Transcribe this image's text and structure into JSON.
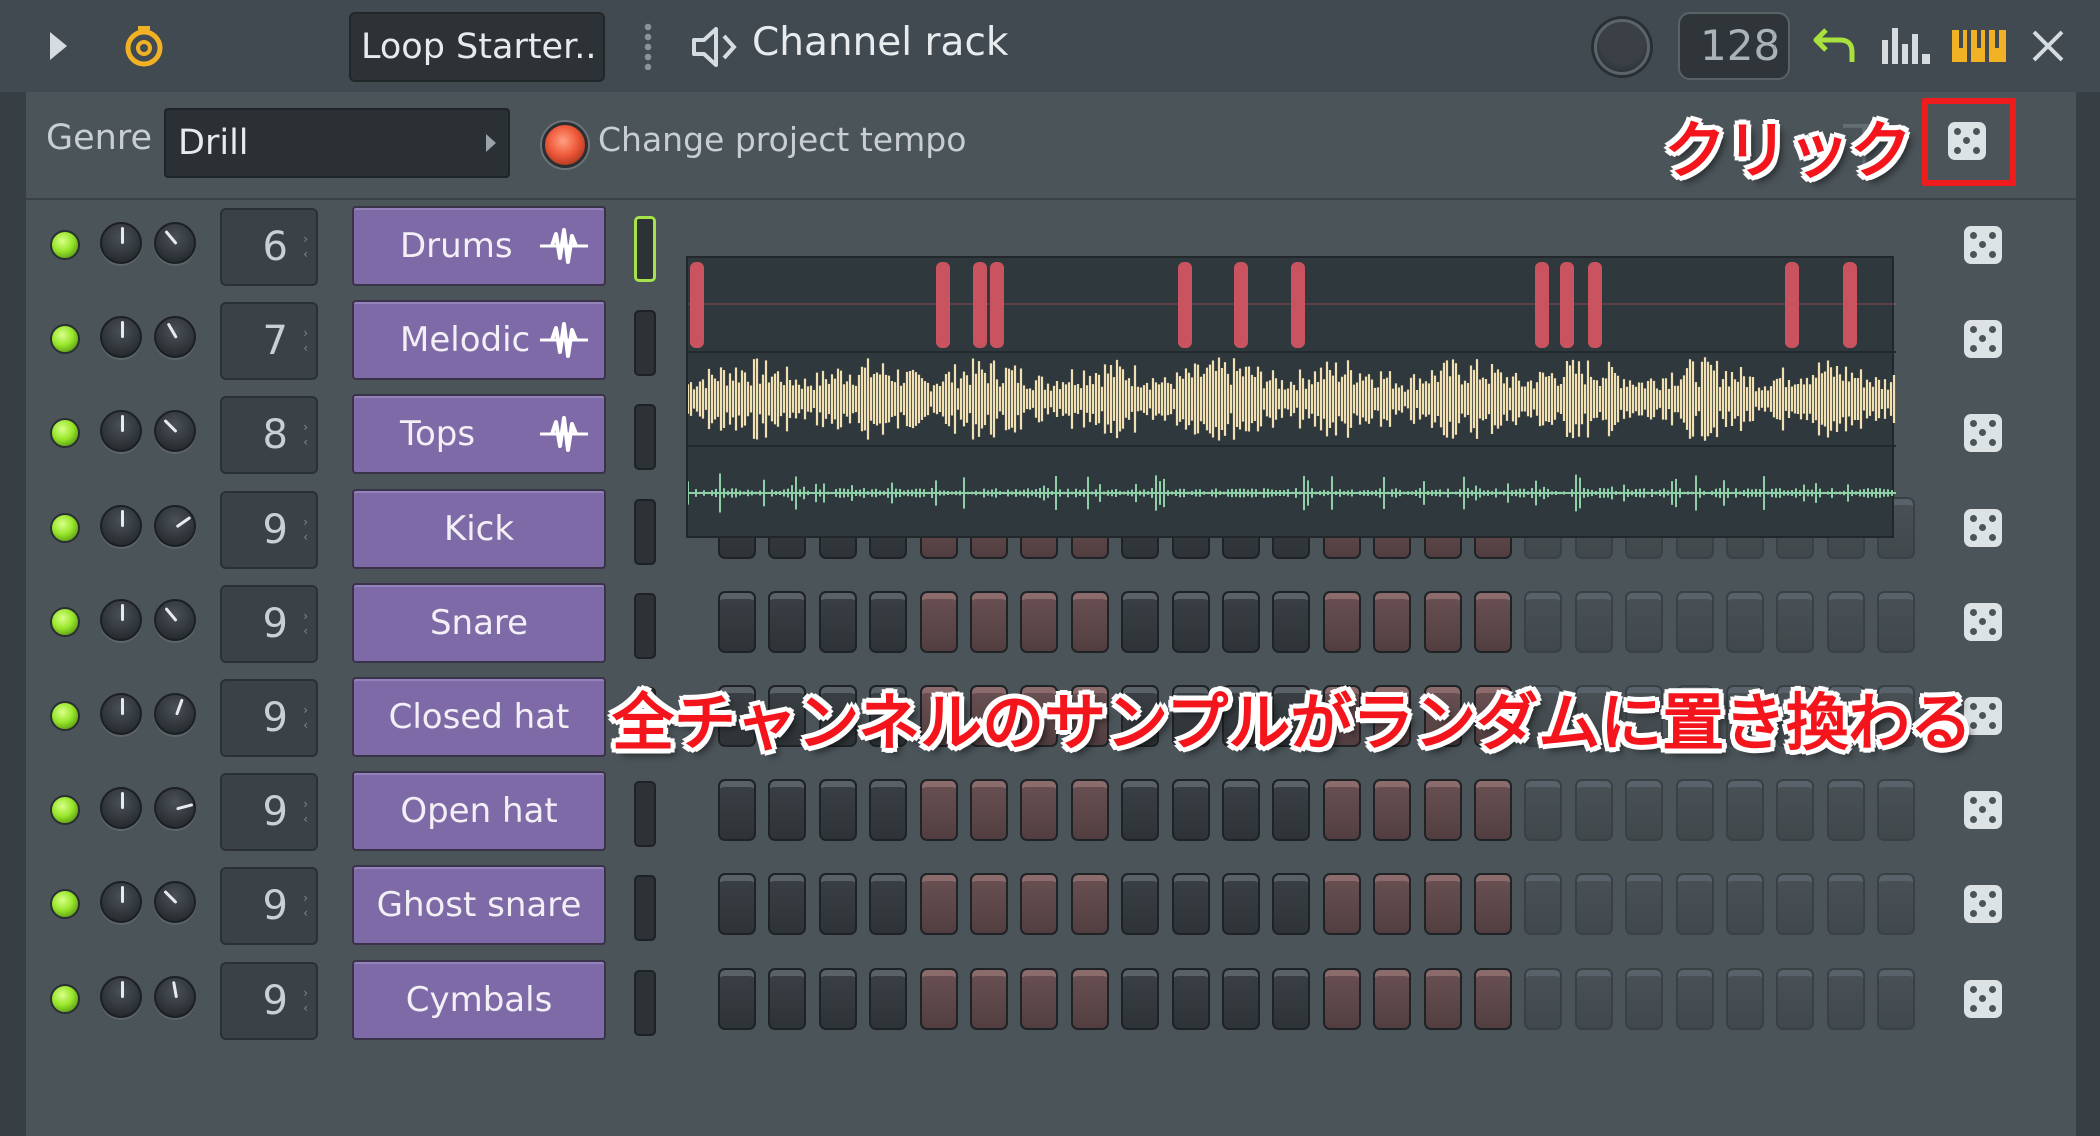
{
  "toolbar": {
    "preset_name": "Loop Starter..",
    "title": "Channel rack",
    "tempo_value": "128",
    "icons": [
      "play-icon",
      "loop-icon",
      "speaker-icon",
      "undo-icon",
      "graph-icon",
      "piano-icon",
      "close-icon"
    ]
  },
  "genre_bar": {
    "genre_label": "Genre",
    "genre_value": "Drill",
    "tempo_toggle_label": "Change project tempo"
  },
  "annotations": {
    "click_label": "クリック",
    "main_label": "全チャンネルのサンプルがランダムに置き換わる"
  },
  "channels": [
    {
      "name": "Drums",
      "route": "6",
      "type": "audio"
    },
    {
      "name": "Melodic",
      "route": "7",
      "type": "audio"
    },
    {
      "name": "Tops",
      "route": "8",
      "type": "audio"
    },
    {
      "name": "Kick",
      "route": "9",
      "type": "steps"
    },
    {
      "name": "Snare",
      "route": "9",
      "type": "steps"
    },
    {
      "name": "Closed hat",
      "route": "9",
      "type": "steps"
    },
    {
      "name": "Open hat",
      "route": "9",
      "type": "steps"
    },
    {
      "name": "Ghost snare",
      "route": "9",
      "type": "steps"
    },
    {
      "name": "Cymbals",
      "route": "9",
      "type": "steps"
    }
  ],
  "steps_per_row": 24,
  "colors": {
    "accent_led": "#98e62a",
    "channel_button": "#7e6aa6",
    "annotation": "#f4151c",
    "drums_clip": "#c9545f",
    "melodic_wave": "#f1e0b2",
    "tops_wave": "#8fcfa7"
  }
}
